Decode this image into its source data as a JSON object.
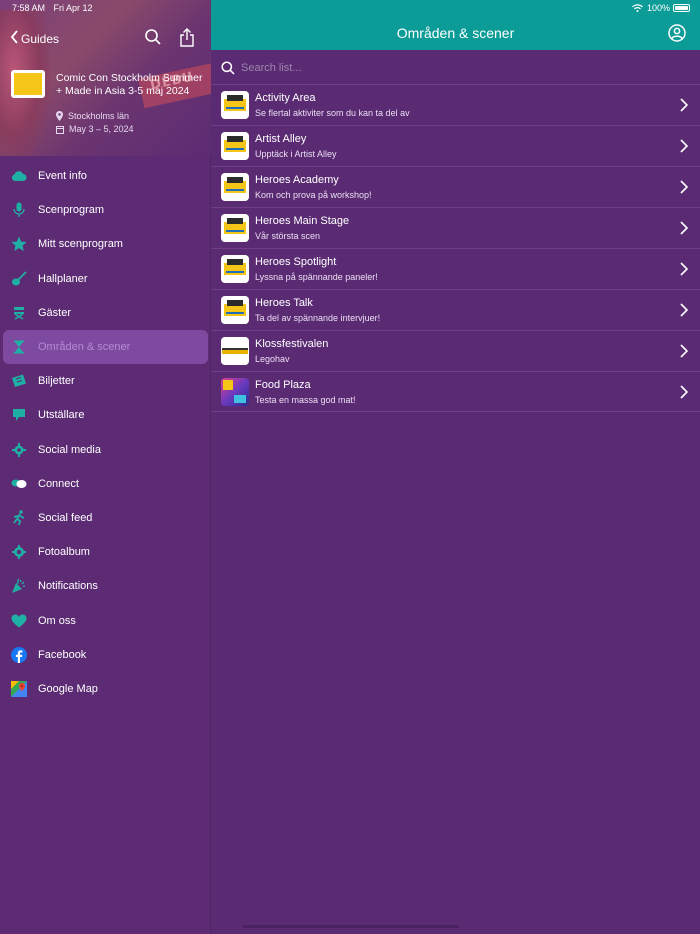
{
  "status": {
    "time": "7:58 AM",
    "date": "Fri Apr 12",
    "battery": "100%"
  },
  "sidebar": {
    "back_label": "Guides",
    "event": {
      "title": "Comic Con Stockholm Summer + Made in Asia 3-5 maj 2024",
      "location": "Stockholms län",
      "dates": "May 3 – 5, 2024"
    },
    "items": [
      {
        "label": "Event info",
        "icon": "cloud-icon"
      },
      {
        "label": "Scenprogram",
        "icon": "microphone-icon"
      },
      {
        "label": "Mitt scenprogram",
        "icon": "star-icon"
      },
      {
        "label": "Hallplaner",
        "icon": "guitar-icon"
      },
      {
        "label": "Gäster",
        "icon": "director-chair-icon"
      },
      {
        "label": "Områden & scener",
        "icon": "hourglass-icon"
      },
      {
        "label": "Biljetter",
        "icon": "ticket-icon"
      },
      {
        "label": "Utställare",
        "icon": "chat-flag-icon"
      },
      {
        "label": "Social media",
        "icon": "gear-people-icon"
      },
      {
        "label": "Connect",
        "icon": "speech-bubbles-icon"
      },
      {
        "label": "Social feed",
        "icon": "runner-icon"
      },
      {
        "label": "Fotoalbum",
        "icon": "camera-gear-icon"
      },
      {
        "label": "Notifications",
        "icon": "confetti-icon"
      },
      {
        "label": "Om oss",
        "icon": "heart-icon"
      },
      {
        "label": "Facebook",
        "icon": "facebook-icon"
      },
      {
        "label": "Google Map",
        "icon": "google-maps-icon"
      }
    ]
  },
  "main": {
    "title": "Områden & scener",
    "search_placeholder": "Search list...",
    "items": [
      {
        "title": "Activity Area",
        "subtitle": "Se flertal aktiviter som du kan ta del av",
        "thumb": "heroes"
      },
      {
        "title": "Artist Alley",
        "subtitle": "Upptäck i Artist Alley",
        "thumb": "heroes"
      },
      {
        "title": "Heroes Academy",
        "subtitle": "Kom och prova på workshop!",
        "thumb": "heroes"
      },
      {
        "title": "Heroes Main Stage",
        "subtitle": "Vår största scen",
        "thumb": "heroes"
      },
      {
        "title": "Heroes Spotlight",
        "subtitle": "Lyssna på spännande paneler!",
        "thumb": "heroes"
      },
      {
        "title": "Heroes Talk",
        "subtitle": "Ta del av spännande intervjuer!",
        "thumb": "heroes"
      },
      {
        "title": "Klossfestivalen",
        "subtitle": "Legohav",
        "thumb": "kloss"
      },
      {
        "title": "Food Plaza",
        "subtitle": "Testa en massa god mat!",
        "thumb": "food"
      }
    ]
  },
  "colors": {
    "topbar": "#0b9c97",
    "background": "#5a2b73",
    "accent_icon": "#1fb0a5",
    "active_bg": "#7e4aa0",
    "active_text": "#b58ad8"
  }
}
